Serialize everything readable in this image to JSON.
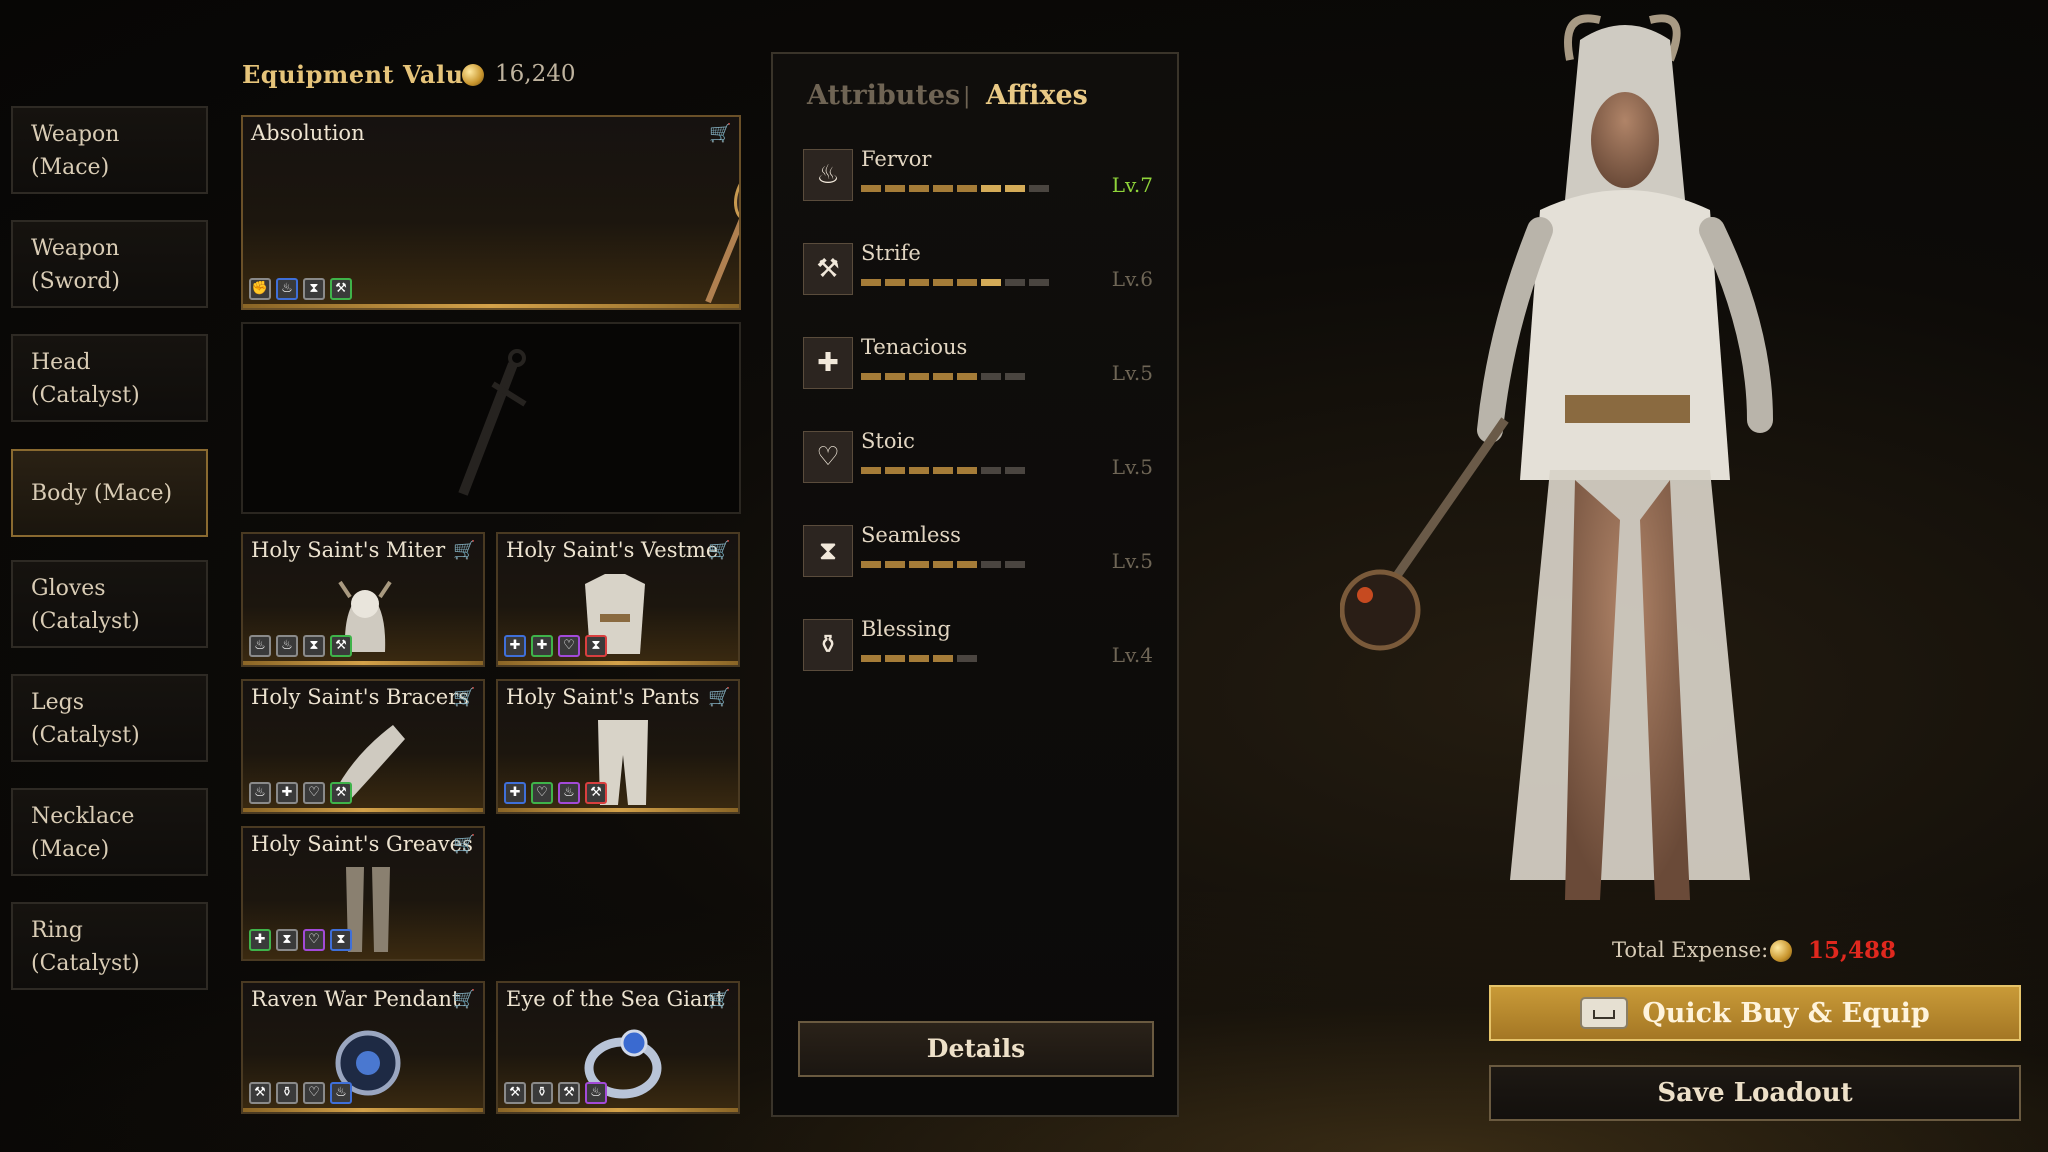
{
  "slots": [
    {
      "label": "Weapon\n(Mace)",
      "active": false
    },
    {
      "label": "Weapon\n(Sword)",
      "active": false
    },
    {
      "label": "Head\n(Catalyst)",
      "active": false
    },
    {
      "label": "Body (Mace)",
      "active": true
    },
    {
      "label": "Gloves\n(Catalyst)",
      "active": false
    },
    {
      "label": "Legs\n(Catalyst)",
      "active": false
    },
    {
      "label": "Necklace\n(Mace)",
      "active": false
    },
    {
      "label": "Ring\n(Catalyst)",
      "active": false
    }
  ],
  "equipment_value": {
    "label": "Equipment Value",
    "value": "16,240",
    "icon": "gold-coin-icon"
  },
  "items": {
    "weapon": {
      "name": "Absolution",
      "badges": [
        "fist-icon",
        "fervor-icon",
        "hourglass-icon",
        "strife-icon"
      ],
      "badge_colors": [
        "gray",
        "blue",
        "gray",
        "green"
      ]
    },
    "head": {
      "name": "Holy Saint's Miter",
      "badges": [
        "fervor-icon",
        "fervor-icon",
        "hourglass-icon",
        "strife-icon"
      ],
      "badge_colors": [
        "gray",
        "gray",
        "gray",
        "green"
      ]
    },
    "body": {
      "name": "Holy Saint's Vestme",
      "badges": [
        "tenacious-icon",
        "tenacious-icon",
        "stoic-icon",
        "hourglass-icon"
      ],
      "badge_colors": [
        "blue",
        "green",
        "purple",
        "red"
      ]
    },
    "gloves": {
      "name": "Holy Saint's Bracers",
      "badges": [
        "fervor-icon",
        "tenacious-icon",
        "stoic-icon",
        "strife-icon"
      ],
      "badge_colors": [
        "gray",
        "gray",
        "gray",
        "green"
      ]
    },
    "legs": {
      "name": "Holy Saint's Pants",
      "badges": [
        "tenacious-icon",
        "stoic-icon",
        "fervor-icon",
        "strife-icon"
      ],
      "badge_colors": [
        "blue",
        "green",
        "purple",
        "red"
      ]
    },
    "feet": {
      "name": "Holy Saint's Greaves",
      "badges": [
        "tenacious-icon",
        "hourglass-icon",
        "stoic-icon",
        "hourglass-icon"
      ],
      "badge_colors": [
        "green",
        "gray",
        "purple",
        "blue"
      ]
    },
    "necklace": {
      "name": "Raven War Pendant",
      "badges": [
        "strife-icon",
        "blessing-icon",
        "stoic-icon",
        "fervor-icon"
      ],
      "badge_colors": [
        "gray",
        "gray",
        "gray",
        "blue"
      ]
    },
    "ring": {
      "name": "Eye of the Sea Giant",
      "badges": [
        "strife-icon",
        "blessing-icon",
        "strife-icon",
        "fervor-icon"
      ],
      "badge_colors": [
        "gray",
        "gray",
        "gray",
        "purple"
      ]
    }
  },
  "panel": {
    "tab_attributes": "Attributes",
    "separator": "|",
    "tab_affixes": "Affixes",
    "affixes": [
      {
        "name": "Fervor",
        "level": "Lv.7",
        "filled": 7,
        "bright": 2,
        "total": 8,
        "max": true,
        "icon": "fervor-icon"
      },
      {
        "name": "Strife",
        "level": "Lv.6",
        "filled": 6,
        "bright": 1,
        "total": 8,
        "max": false,
        "icon": "strife-icon"
      },
      {
        "name": "Tenacious",
        "level": "Lv.5",
        "filled": 5,
        "bright": 0,
        "total": 7,
        "max": false,
        "icon": "tenacious-icon"
      },
      {
        "name": "Stoic",
        "level": "Lv.5",
        "filled": 5,
        "bright": 0,
        "total": 7,
        "max": false,
        "icon": "stoic-icon"
      },
      {
        "name": "Seamless",
        "level": "Lv.5",
        "filled": 5,
        "bright": 0,
        "total": 7,
        "max": false,
        "icon": "hourglass-icon"
      },
      {
        "name": "Blessing",
        "level": "Lv.4",
        "filled": 4,
        "bright": 0,
        "total": 5,
        "max": false,
        "icon": "blessing-icon"
      }
    ],
    "details_label": "Details"
  },
  "footer": {
    "expense_label": "Total Expense:",
    "expense_value": "15,488",
    "buy_label": "Quick Buy & Equip",
    "save_label": "Save Loadout"
  },
  "colors": {
    "accent_gold": "#e9c985",
    "expense_red": "#e0281e",
    "max_level_green": "#8fd43a"
  }
}
